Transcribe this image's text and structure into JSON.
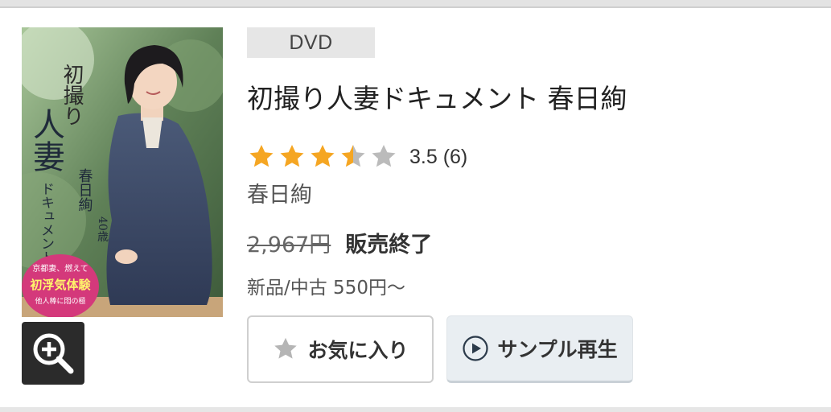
{
  "product": {
    "format": "DVD",
    "title": "初撮り人妻ドキュメント 春日絢",
    "rating_value": 3.5,
    "rating_text": "3.5 (6)",
    "rating_max": 5,
    "actress": "春日絢",
    "list_price": "2,967円",
    "status": "販売終了",
    "used_price": "新品/中古 550円～"
  },
  "cover": {
    "title_line1": "初撮り",
    "title_line2": "人妻",
    "title_line3": "ドキュメント",
    "name": "春日絢",
    "age": "40歳",
    "tagline_top": "京都妻、燃えて",
    "tagline_main": "初浮気体験",
    "tagline_sub": "他人棒に悶の極"
  },
  "actions": {
    "favorite_label": "お気に入り",
    "sample_label": "サンプル再生"
  },
  "icons": {
    "zoom": "zoom-in-icon",
    "favorite": "star-icon",
    "sample": "play-icon"
  },
  "colors": {
    "star_filled": "#f5a623",
    "star_empty": "#bbbbbb",
    "badge_bg": "#e6e6e6",
    "sample_bg": "#e9eef2"
  }
}
